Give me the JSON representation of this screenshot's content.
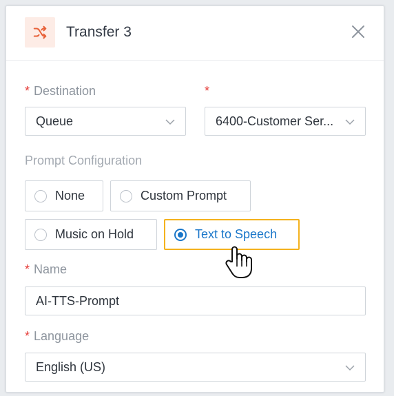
{
  "dialog": {
    "title": "Transfer 3",
    "accent_color": "#e8623a",
    "icon": "shuffle-icon",
    "close_icon": "close-icon"
  },
  "destination": {
    "label": "Destination",
    "required_mark": "*",
    "type_value": "Queue",
    "target_required_mark": "*",
    "target_value": "6400-Customer Ser..."
  },
  "prompt": {
    "section_label": "Prompt Configuration",
    "options": [
      {
        "label": "None",
        "selected": false
      },
      {
        "label": "Custom Prompt",
        "selected": false
      },
      {
        "label": "Music on Hold",
        "selected": false
      },
      {
        "label": "Text to Speech",
        "selected": true
      }
    ],
    "selected_color": "#1976c9",
    "highlight_color": "#f4b21d"
  },
  "name": {
    "label": "Name",
    "required_mark": "*",
    "value": "AI-TTS-Prompt"
  },
  "language": {
    "label": "Language",
    "required_mark": "*",
    "value": "English (US)"
  }
}
